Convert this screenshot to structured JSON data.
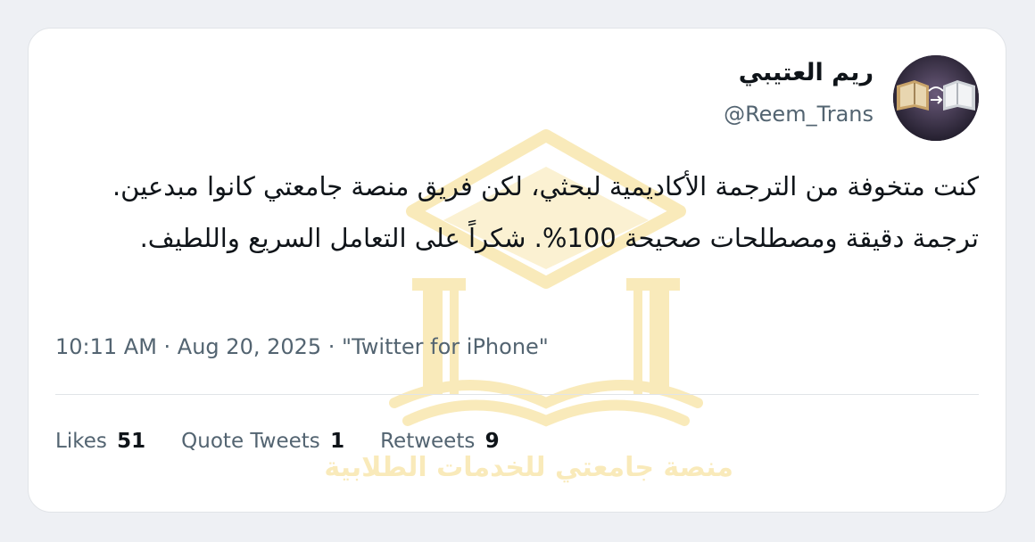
{
  "tweet": {
    "display_name": "ريم العتيبي",
    "handle": "@Reem_Trans",
    "text": "كنت متخوفة من الترجمة الأكاديمية لبحثي، لكن فريق منصة جامعتي كانوا مبدعين. ترجمة دقيقة ومصطلحات صحيحة 100%. شكراً على التعامل السريع واللطيف.",
    "meta": "10:11 AM · Aug 20, 2025 · \"Twitter for iPhone\"",
    "stats": {
      "likes_label": "Likes",
      "likes_count": "51",
      "quotes_label": "Quote Tweets",
      "quotes_count": "1",
      "retweets_label": "Retweets",
      "retweets_count": "9"
    }
  },
  "watermark": {
    "text": "منصة جامعتي للخدمات الطلابية",
    "color": "#f1c94b"
  },
  "avatar": {
    "icon": "books-translation-icon"
  }
}
